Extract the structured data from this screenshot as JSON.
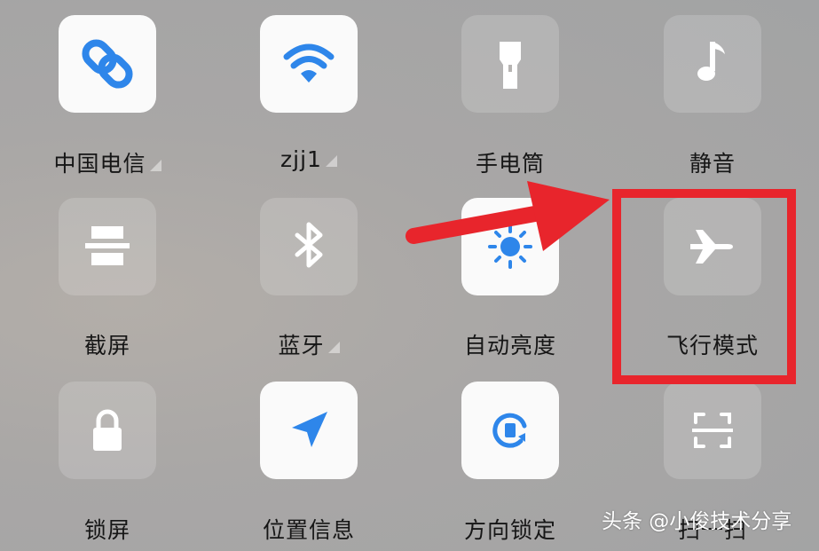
{
  "tiles": [
    {
      "label": "中国电信",
      "icon": "link-icon",
      "state": "on",
      "has_menu": true
    },
    {
      "label": "zjj1",
      "icon": "wifi-icon",
      "state": "on",
      "has_menu": true
    },
    {
      "label": "手电筒",
      "icon": "flashlight-icon",
      "state": "off",
      "has_menu": false
    },
    {
      "label": "静音",
      "icon": "music-note-icon",
      "state": "off",
      "has_menu": false
    },
    {
      "label": "截屏",
      "icon": "screenshot-icon",
      "state": "off",
      "has_menu": false
    },
    {
      "label": "蓝牙",
      "icon": "bluetooth-icon",
      "state": "off",
      "has_menu": true
    },
    {
      "label": "自动亮度",
      "icon": "brightness-icon",
      "state": "on",
      "has_menu": false
    },
    {
      "label": "飞行模式",
      "icon": "airplane-icon",
      "state": "off",
      "has_menu": false
    },
    {
      "label": "锁屏",
      "icon": "lock-icon",
      "state": "off",
      "has_menu": false
    },
    {
      "label": "位置信息",
      "icon": "location-icon",
      "state": "on",
      "has_menu": false
    },
    {
      "label": "方向锁定",
      "icon": "rotation-lock-icon",
      "state": "on",
      "has_menu": false
    },
    {
      "label": "扫一扫",
      "icon": "scan-icon",
      "state": "off",
      "has_menu": false
    }
  ],
  "annotation": {
    "target": "飞行模式",
    "color": "#e8252c"
  },
  "watermark": "头条 @小俊技术分享",
  "colors": {
    "accent_blue": "#2e86ea",
    "tile_on": "#fafafa",
    "label_text": "#161616"
  }
}
